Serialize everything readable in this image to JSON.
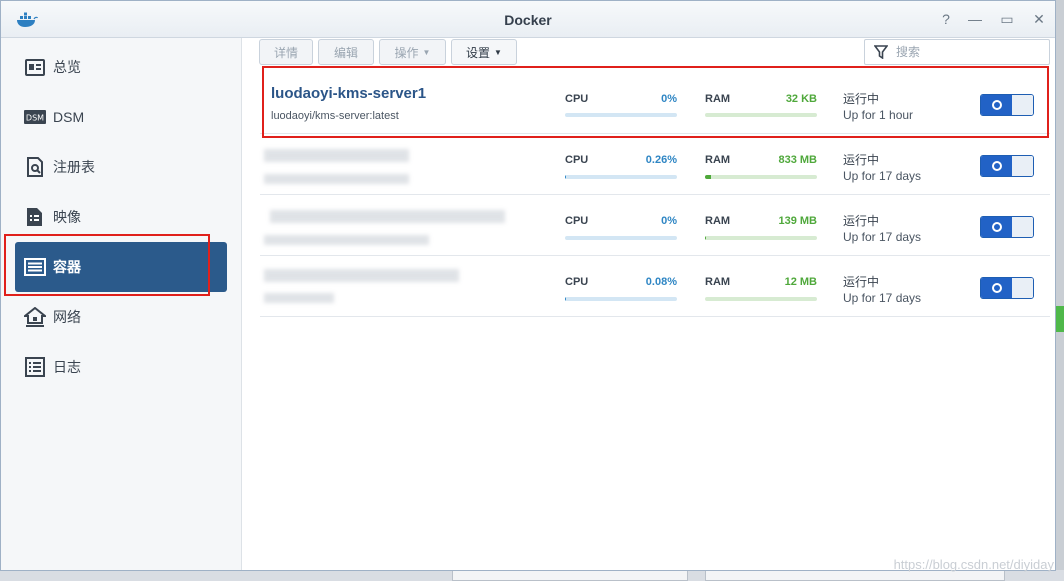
{
  "window": {
    "title": "Docker"
  },
  "sidebar": {
    "items": [
      {
        "label": "总览",
        "icon": "overview-icon"
      },
      {
        "label": "DSM",
        "icon": "dsm-icon"
      },
      {
        "label": "注册表",
        "icon": "registry-icon"
      },
      {
        "label": "映像",
        "icon": "image-icon"
      },
      {
        "label": "容器",
        "icon": "container-icon",
        "active": true
      },
      {
        "label": "网络",
        "icon": "network-icon"
      },
      {
        "label": "日志",
        "icon": "log-icon"
      }
    ]
  },
  "toolbar": {
    "details": "详情",
    "edit": "编辑",
    "action": "操作",
    "settings": "设置",
    "search_placeholder": "搜索"
  },
  "containers": [
    {
      "name": "luodaoyi-kms-server1",
      "image": "luodaoyi/kms-server:latest",
      "cpu_label": "CPU",
      "cpu": "0%",
      "cpu_fraction": 0.0,
      "ram_label": "RAM",
      "ram": "32 KB",
      "ram_fraction": 0.0,
      "status": "运行中",
      "uptime": "Up for 1 hour",
      "running": true
    },
    {
      "name": "",
      "image": "",
      "cpu_label": "CPU",
      "cpu": "0.26%",
      "cpu_fraction": 0.0026,
      "ram_label": "RAM",
      "ram": "833 MB",
      "ram_fraction": 0.05,
      "status": "运行中",
      "uptime": "Up for 17 days",
      "running": true
    },
    {
      "name": "",
      "image": "",
      "cpu_label": "CPU",
      "cpu": "0%",
      "cpu_fraction": 0.0,
      "ram_label": "RAM",
      "ram": "139 MB",
      "ram_fraction": 0.01,
      "status": "运行中",
      "uptime": "Up for 17 days",
      "running": true
    },
    {
      "name": "",
      "image": "",
      "cpu_label": "CPU",
      "cpu": "0.08%",
      "cpu_fraction": 0.0008,
      "ram_label": "RAM",
      "ram": "12 MB",
      "ram_fraction": 0.0,
      "status": "运行中",
      "uptime": "Up for 17 days",
      "running": true
    }
  ],
  "watermark": "https://blog.csdn.net/diyiday",
  "colors": {
    "accent": "#2b5a8b",
    "highlight": "#e0201b",
    "cpu": "#2f86c4",
    "ram": "#4fa83b"
  }
}
